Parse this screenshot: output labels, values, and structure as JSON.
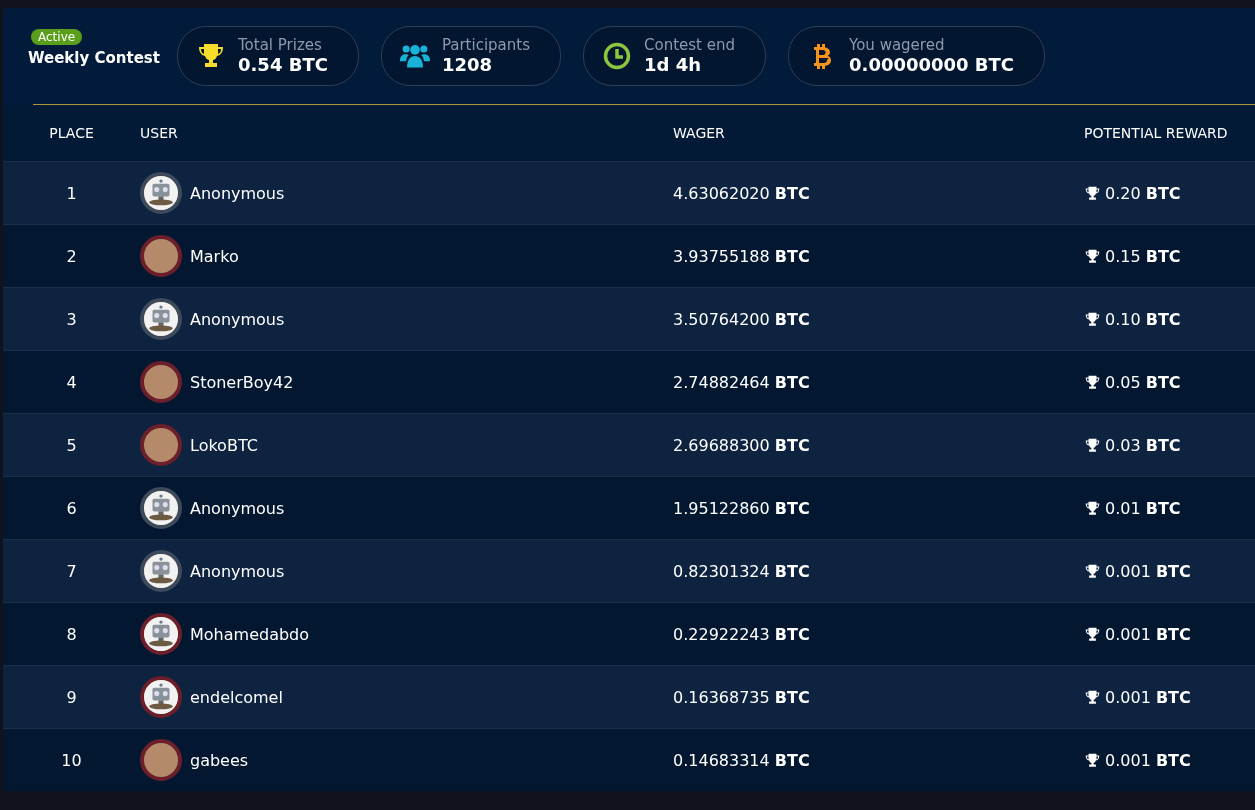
{
  "contest": {
    "status": "Active",
    "title": "Weekly Contest"
  },
  "stats": [
    {
      "kind": "trophy",
      "label": "Total Prizes",
      "value": "0.54 BTC"
    },
    {
      "kind": "users",
      "label": "Participants",
      "value": "1208"
    },
    {
      "kind": "clock",
      "label": "Contest end",
      "value": "1d 4h"
    },
    {
      "kind": "bitcoin",
      "label": "You wagered",
      "value": "0.00000000 BTC"
    }
  ],
  "table": {
    "columns": [
      "PLACE",
      "USER",
      "WAGER",
      "POTENTIAL REWARD"
    ],
    "rows": [
      {
        "place": "1",
        "user": "Anonymous",
        "avatar": {
          "kind": "robot",
          "color": "#3d4a5c"
        },
        "wager": "4.63062020 **BTC**",
        "reward": "0.20 **BTC**"
      },
      {
        "place": "2",
        "user": "Marko",
        "avatar": {
          "kind": "photo",
          "color": "#6b1f2a"
        },
        "wager": "3.93755188 **BTC**",
        "reward": "0.15 **BTC**"
      },
      {
        "place": "3",
        "user": "Anonymous",
        "avatar": {
          "kind": "robot",
          "color": "#3d4a5c"
        },
        "wager": "3.50764200 **BTC**",
        "reward": "0.10 **BTC**"
      },
      {
        "place": "4",
        "user": "StonerBoy42",
        "avatar": {
          "kind": "photo",
          "color": "#6b1f2a"
        },
        "wager": "2.74882464 **BTC**",
        "reward": "0.05 **BTC**"
      },
      {
        "place": "5",
        "user": "LokoBTC",
        "avatar": {
          "kind": "photo",
          "color": "#6b1f2a"
        },
        "wager": "2.69688300 **BTC**",
        "reward": "0.03 **BTC**"
      },
      {
        "place": "6",
        "user": "Anonymous",
        "avatar": {
          "kind": "robot",
          "color": "#3d4a5c"
        },
        "wager": "1.95122860 **BTC**",
        "reward": "0.01 **BTC**"
      },
      {
        "place": "7",
        "user": "Anonymous",
        "avatar": {
          "kind": "robot",
          "color": "#3d4a5c"
        },
        "wager": "0.82301324 **BTC**",
        "reward": "0.001 **BTC**"
      },
      {
        "place": "8",
        "user": "Mohamedabdo",
        "avatar": {
          "kind": "robot",
          "color": "#6b1f2a"
        },
        "wager": "0.22922243 **BTC**",
        "reward": "0.001 **BTC**"
      },
      {
        "place": "9",
        "user": "endelcomel",
        "avatar": {
          "kind": "robot",
          "color": "#6b1f2a"
        },
        "wager": "0.16368735 **BTC**",
        "reward": "0.001 **BTC**"
      },
      {
        "place": "10",
        "user": "gabees",
        "avatar": {
          "kind": "photo",
          "color": "#6b1f2a"
        },
        "wager": "0.14683314 **BTC**",
        "reward": "0.001 **BTC**"
      }
    ]
  }
}
